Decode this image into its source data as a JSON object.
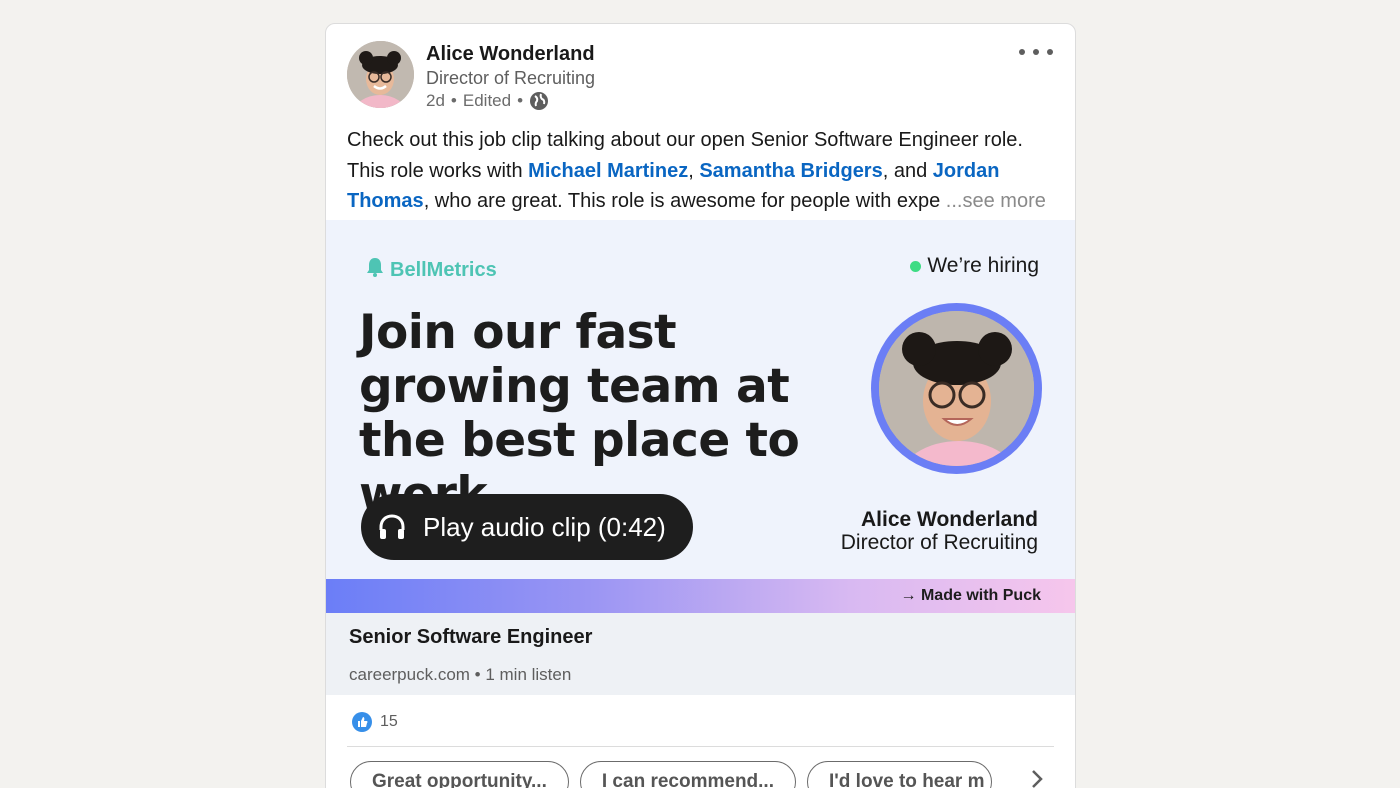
{
  "post": {
    "author_name": "Alice Wonderland",
    "author_title": "Director of Recruiting",
    "time": "2d",
    "edited": "Edited",
    "separator": "•",
    "text_1": "Check out this job clip talking about our open Senior Software Engineer role. This role works with ",
    "mention_1": "Michael Martinez",
    "text_2": ", ",
    "mention_2": "Samantha Bridgers",
    "text_3": ", and ",
    "mention_3": "Jordan Thomas",
    "text_4": ", who are great. This role is awesome for people with expe",
    "see_more": " ...see more"
  },
  "clip": {
    "brand": "BellMetrics",
    "hiring": "We’re hiring",
    "headline": "Join our fast growing team at the best place to work.",
    "play_label": "Play audio clip (0:42)",
    "speaker_name": "Alice Wonderland",
    "speaker_title": "Director of Recruiting",
    "made_with": "→ Made with Puck"
  },
  "link_preview": {
    "title": "Senior Software Engineer",
    "meta": "careerpuck.com • 1 min listen"
  },
  "reactions": {
    "count": "15"
  },
  "suggestions": [
    "Great opportunity...",
    "I can recommend...",
    "I'd love to hear m"
  ],
  "colors": {
    "mention": "#0a66c2",
    "brand": "#4ec4b4",
    "ring": "#6b7ef5",
    "play_bg": "#1e1e1e"
  }
}
